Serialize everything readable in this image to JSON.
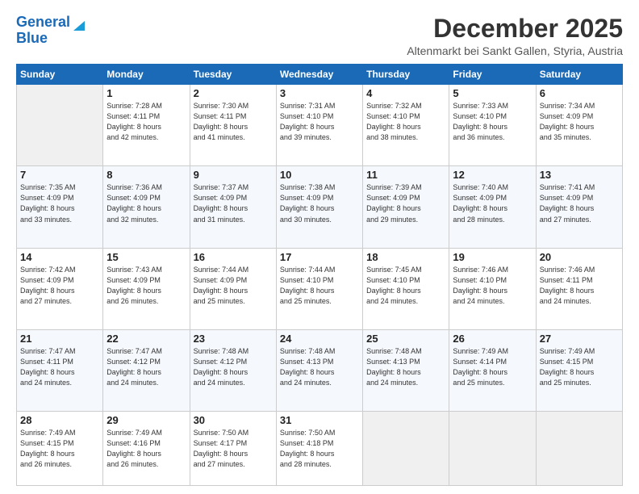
{
  "logo": {
    "line1": "General",
    "line2": "Blue"
  },
  "title": "December 2025",
  "location": "Altenmarkt bei Sankt Gallen, Styria, Austria",
  "days_of_week": [
    "Sunday",
    "Monday",
    "Tuesday",
    "Wednesday",
    "Thursday",
    "Friday",
    "Saturday"
  ],
  "weeks": [
    [
      {
        "day": "",
        "content": ""
      },
      {
        "day": "1",
        "content": "Sunrise: 7:28 AM\nSunset: 4:11 PM\nDaylight: 8 hours\nand 42 minutes."
      },
      {
        "day": "2",
        "content": "Sunrise: 7:30 AM\nSunset: 4:11 PM\nDaylight: 8 hours\nand 41 minutes."
      },
      {
        "day": "3",
        "content": "Sunrise: 7:31 AM\nSunset: 4:10 PM\nDaylight: 8 hours\nand 39 minutes."
      },
      {
        "day": "4",
        "content": "Sunrise: 7:32 AM\nSunset: 4:10 PM\nDaylight: 8 hours\nand 38 minutes."
      },
      {
        "day": "5",
        "content": "Sunrise: 7:33 AM\nSunset: 4:10 PM\nDaylight: 8 hours\nand 36 minutes."
      },
      {
        "day": "6",
        "content": "Sunrise: 7:34 AM\nSunset: 4:09 PM\nDaylight: 8 hours\nand 35 minutes."
      }
    ],
    [
      {
        "day": "7",
        "content": "Sunrise: 7:35 AM\nSunset: 4:09 PM\nDaylight: 8 hours\nand 33 minutes."
      },
      {
        "day": "8",
        "content": "Sunrise: 7:36 AM\nSunset: 4:09 PM\nDaylight: 8 hours\nand 32 minutes."
      },
      {
        "day": "9",
        "content": "Sunrise: 7:37 AM\nSunset: 4:09 PM\nDaylight: 8 hours\nand 31 minutes."
      },
      {
        "day": "10",
        "content": "Sunrise: 7:38 AM\nSunset: 4:09 PM\nDaylight: 8 hours\nand 30 minutes."
      },
      {
        "day": "11",
        "content": "Sunrise: 7:39 AM\nSunset: 4:09 PM\nDaylight: 8 hours\nand 29 minutes."
      },
      {
        "day": "12",
        "content": "Sunrise: 7:40 AM\nSunset: 4:09 PM\nDaylight: 8 hours\nand 28 minutes."
      },
      {
        "day": "13",
        "content": "Sunrise: 7:41 AM\nSunset: 4:09 PM\nDaylight: 8 hours\nand 27 minutes."
      }
    ],
    [
      {
        "day": "14",
        "content": "Sunrise: 7:42 AM\nSunset: 4:09 PM\nDaylight: 8 hours\nand 27 minutes."
      },
      {
        "day": "15",
        "content": "Sunrise: 7:43 AM\nSunset: 4:09 PM\nDaylight: 8 hours\nand 26 minutes."
      },
      {
        "day": "16",
        "content": "Sunrise: 7:44 AM\nSunset: 4:09 PM\nDaylight: 8 hours\nand 25 minutes."
      },
      {
        "day": "17",
        "content": "Sunrise: 7:44 AM\nSunset: 4:10 PM\nDaylight: 8 hours\nand 25 minutes."
      },
      {
        "day": "18",
        "content": "Sunrise: 7:45 AM\nSunset: 4:10 PM\nDaylight: 8 hours\nand 24 minutes."
      },
      {
        "day": "19",
        "content": "Sunrise: 7:46 AM\nSunset: 4:10 PM\nDaylight: 8 hours\nand 24 minutes."
      },
      {
        "day": "20",
        "content": "Sunrise: 7:46 AM\nSunset: 4:11 PM\nDaylight: 8 hours\nand 24 minutes."
      }
    ],
    [
      {
        "day": "21",
        "content": "Sunrise: 7:47 AM\nSunset: 4:11 PM\nDaylight: 8 hours\nand 24 minutes."
      },
      {
        "day": "22",
        "content": "Sunrise: 7:47 AM\nSunset: 4:12 PM\nDaylight: 8 hours\nand 24 minutes."
      },
      {
        "day": "23",
        "content": "Sunrise: 7:48 AM\nSunset: 4:12 PM\nDaylight: 8 hours\nand 24 minutes."
      },
      {
        "day": "24",
        "content": "Sunrise: 7:48 AM\nSunset: 4:13 PM\nDaylight: 8 hours\nand 24 minutes."
      },
      {
        "day": "25",
        "content": "Sunrise: 7:48 AM\nSunset: 4:13 PM\nDaylight: 8 hours\nand 24 minutes."
      },
      {
        "day": "26",
        "content": "Sunrise: 7:49 AM\nSunset: 4:14 PM\nDaylight: 8 hours\nand 25 minutes."
      },
      {
        "day": "27",
        "content": "Sunrise: 7:49 AM\nSunset: 4:15 PM\nDaylight: 8 hours\nand 25 minutes."
      }
    ],
    [
      {
        "day": "28",
        "content": "Sunrise: 7:49 AM\nSunset: 4:15 PM\nDaylight: 8 hours\nand 26 minutes."
      },
      {
        "day": "29",
        "content": "Sunrise: 7:49 AM\nSunset: 4:16 PM\nDaylight: 8 hours\nand 26 minutes."
      },
      {
        "day": "30",
        "content": "Sunrise: 7:50 AM\nSunset: 4:17 PM\nDaylight: 8 hours\nand 27 minutes."
      },
      {
        "day": "31",
        "content": "Sunrise: 7:50 AM\nSunset: 4:18 PM\nDaylight: 8 hours\nand 28 minutes."
      },
      {
        "day": "",
        "content": ""
      },
      {
        "day": "",
        "content": ""
      },
      {
        "day": "",
        "content": ""
      }
    ]
  ]
}
